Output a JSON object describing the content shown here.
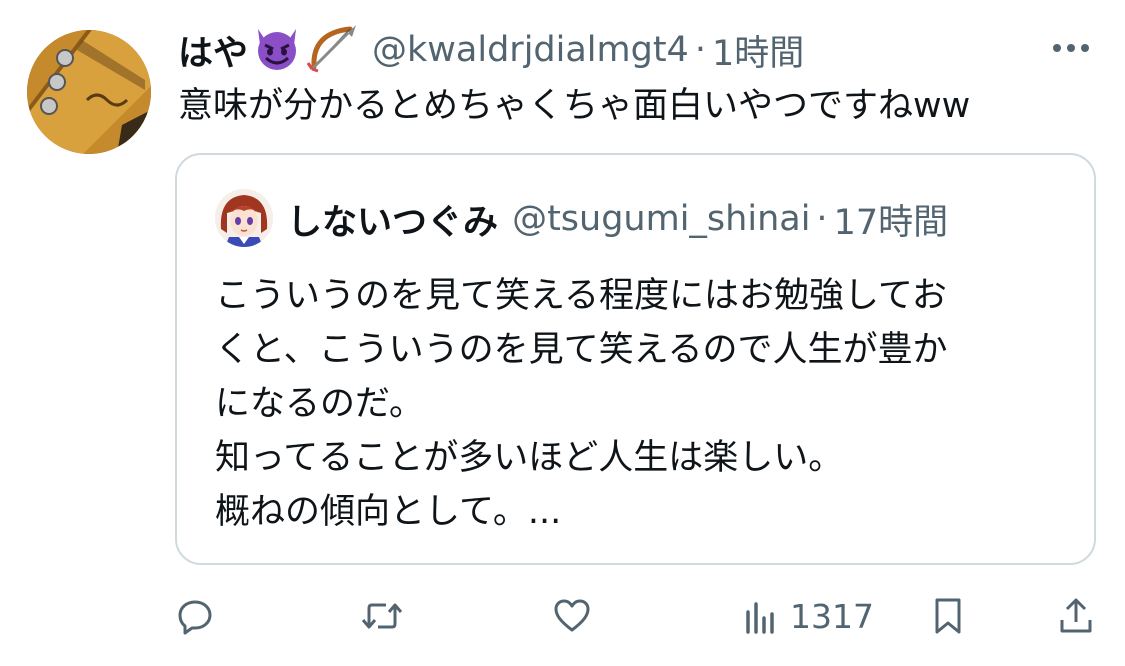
{
  "tweet": {
    "display_name": "はや",
    "emojis": [
      "smiling-devil-emoji",
      "bow-and-arrow-emoji"
    ],
    "handle": "@kwaldrjdialmgt4",
    "separator": "·",
    "time": "1時間",
    "text": "意味が分かるとめちゃくちゃ面白いやつですねww",
    "avatar": "guitar-headstock-avatar"
  },
  "quote": {
    "display_name": "しないつぐみ",
    "handle": "@tsugumi_shinai",
    "separator": "·",
    "time": "17時間",
    "avatar": "anime-girl-avatar",
    "lines": [
      "こういうのを見て笑える程度にはお勉強してお",
      "くと、こういうのを見て笑えるので人生が豊か",
      "になるのだ。",
      "知ってることが多いほど人生は楽しい。",
      "概ねの傾向として。..."
    ]
  },
  "actions": {
    "reply_icon": "reply-icon",
    "retweet_icon": "retweet-icon",
    "like_icon": "heart-icon",
    "views_icon": "views-icon",
    "views_count": "1317",
    "bookmark_icon": "bookmark-icon",
    "share_icon": "share-icon"
  },
  "colors": {
    "text": "#0f1419",
    "secondary": "#536471",
    "border": "#cfd9de",
    "devil_purple": "#8a4fc7"
  }
}
